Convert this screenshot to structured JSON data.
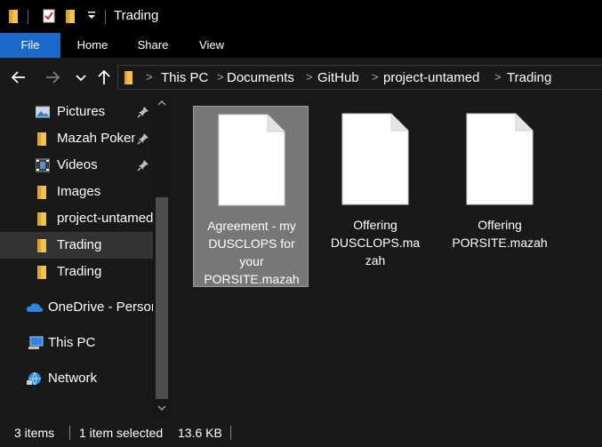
{
  "window": {
    "title": "Trading"
  },
  "ribbon": {
    "tabs": [
      "File",
      "Home",
      "Share",
      "View"
    ]
  },
  "address": {
    "crumbs": [
      "This PC",
      "Documents",
      "GitHub",
      "project-untamed",
      "Trading"
    ],
    "separator": ">"
  },
  "sidebar": {
    "items": [
      {
        "label": "Pictures",
        "icon": "pictures-icon",
        "pinned": true
      },
      {
        "label": "Mazah Pokem",
        "icon": "folder-icon",
        "pinned": true
      },
      {
        "label": "Videos",
        "icon": "videos-icon",
        "pinned": true
      },
      {
        "label": "Images",
        "icon": "folder-icon",
        "pinned": false
      },
      {
        "label": "project-untamed",
        "icon": "folder-icon",
        "pinned": false
      },
      {
        "label": "Trading",
        "icon": "folder-icon",
        "pinned": false,
        "selected": true
      },
      {
        "label": "Trading",
        "icon": "folder-icon",
        "pinned": false
      },
      {
        "label": "OneDrive - Personal",
        "icon": "onedrive-icon",
        "pinned": false
      },
      {
        "label": "This PC",
        "icon": "pc-icon",
        "pinned": false
      },
      {
        "label": "Network",
        "icon": "network-icon",
        "pinned": false
      }
    ]
  },
  "files": [
    {
      "name": "Agreement - my DUSCLOPS for your PORSITE.mazah",
      "icon": "document-icon",
      "selected": true
    },
    {
      "name": "Offering DUSCLOPS.mazah",
      "icon": "document-icon",
      "selected": false
    },
    {
      "name": "Offering PORSITE.mazah",
      "icon": "document-icon",
      "selected": false
    }
  ],
  "status": {
    "item_count": "3 items",
    "selection": "1 item selected",
    "size": "13.6 KB"
  },
  "colors": {
    "accent": "#1b6ac9",
    "folder": "#f2c14e",
    "selection": "#777777"
  }
}
